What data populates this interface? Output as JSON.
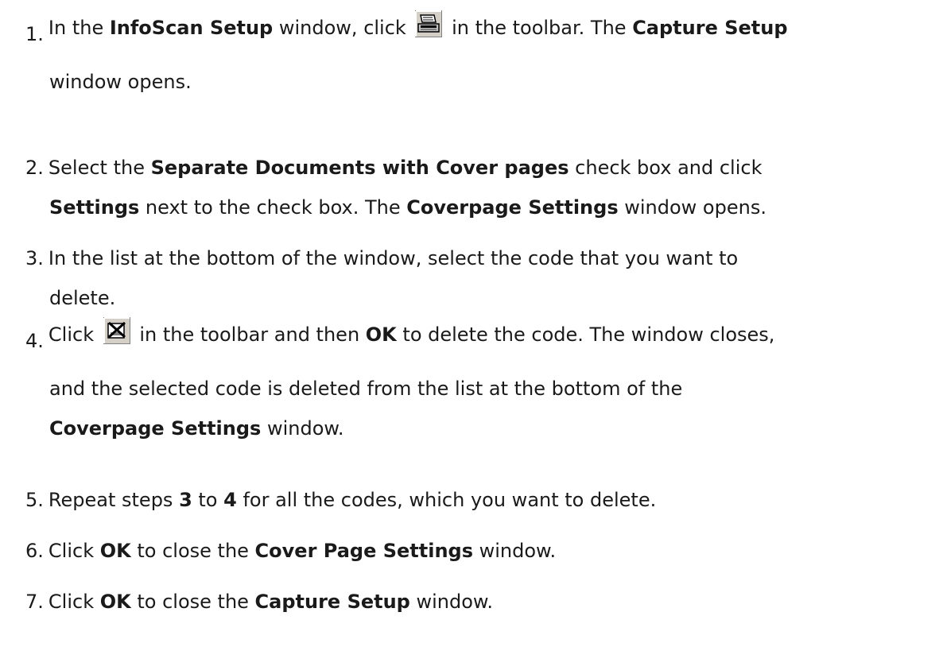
{
  "steps": [
    {
      "num": "1.",
      "line1_a": "In the ",
      "line1_b": "InfoScan Setup",
      "line1_c": " window, click ",
      "icon": "capture-setup-icon",
      "line1_d": " in the toolbar. The ",
      "line1_e": "Capture Setup",
      "line2_a": "window opens."
    },
    {
      "num": "2.",
      "line1_a": "Select the ",
      "line1_b": "Separate Documents with Cover pages",
      "line1_c": " check box and click",
      "line2_a": "Settings",
      "line2_b": " next to the check box. The ",
      "line2_c": "Coverpage Settings",
      "line2_d": " window opens."
    },
    {
      "num": "3.",
      "line1_a": "In the list at the bottom of the window, select the code that you want to",
      "line2_a": "delete."
    },
    {
      "num": "4.",
      "line1_a": "Click ",
      "icon": "delete-code-icon",
      "line1_b": " in the toolbar and then ",
      "line1_c": "OK",
      "line1_d": " to delete the code. The window closes,",
      "line2_a": "and the selected code is deleted from the list at the bottom of the",
      "line3_a": "Coverpage Settings",
      "line3_b": " window."
    },
    {
      "num": "5.",
      "line1_a": "Repeat steps ",
      "line1_b": "3",
      "line1_c": " to ",
      "line1_d": "4",
      "line1_e": " for all the codes, which you want to delete."
    },
    {
      "num": "6.",
      "line1_a": "Click ",
      "line1_b": "OK",
      "line1_c": " to close the ",
      "line1_d": "Cover Page Settings",
      "line1_e": " window."
    },
    {
      "num": "7.",
      "line1_a": "Click ",
      "line1_b": "OK",
      "line1_c": " to close the ",
      "line1_d": "Capture Setup",
      "line1_e": " window."
    }
  ]
}
